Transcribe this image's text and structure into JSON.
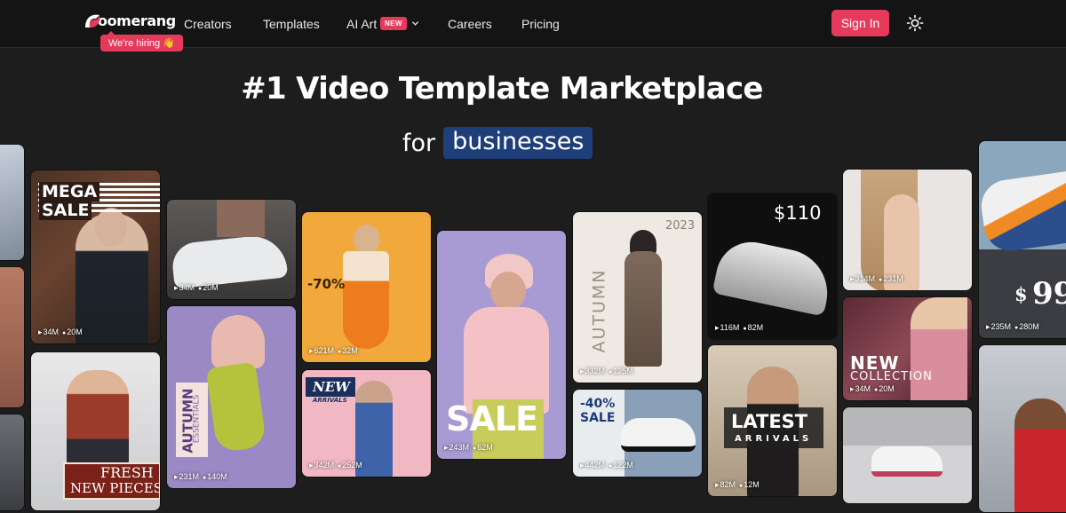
{
  "nav": {
    "logo_text": "oomerang",
    "hiring_label": "We're hiring 👋",
    "items": [
      {
        "label": "Creators"
      },
      {
        "label": "Templates"
      },
      {
        "label": "AI Art",
        "badge": "NEW"
      },
      {
        "label": "Careers"
      },
      {
        "label": "Pricing"
      }
    ],
    "signin_label": "Sign In",
    "theme_icon": "sun-icon"
  },
  "hero": {
    "title": "#1 Video Template Marketplace",
    "sub_prefix": "for",
    "sub_highlight": "businesses"
  },
  "colors": {
    "accent": "#e63a5c",
    "highlight": "#1f3f7a",
    "background": "#1d1d1d"
  },
  "templates": [
    {
      "id": "left-edge-top",
      "views": "",
      "likes": ""
    },
    {
      "id": "mega-sale",
      "overlay": [
        "MEGA",
        "SALE"
      ],
      "views": "34M",
      "likes": "20M"
    },
    {
      "id": "fresh-new-pieces",
      "overlay": [
        "FRESH",
        "NEW PIECES"
      ],
      "views": "",
      "likes": ""
    },
    {
      "id": "sneaker-closeup",
      "views": "34M",
      "likes": "20M"
    },
    {
      "id": "autumn-essentials",
      "overlay": [
        "AUTUMN",
        "ESSENTIALS"
      ],
      "views": "231M",
      "likes": "140M"
    },
    {
      "id": "seventy-off",
      "overlay": [
        "-70%"
      ],
      "views": "621M",
      "likes": "32M"
    },
    {
      "id": "new-arrivals",
      "overlay": [
        "NEW",
        "ARRIVALS"
      ],
      "views": "342M",
      "likes": "252M"
    },
    {
      "id": "sale-purple",
      "overlay": [
        "SALE"
      ],
      "views": "243M",
      "likes": "62M"
    },
    {
      "id": "autumn-2023",
      "overlay": [
        "2023",
        "AUTUMN"
      ],
      "views": "332M",
      "likes": "125M"
    },
    {
      "id": "forty-off-sale",
      "overlay": [
        "-40%",
        "SALE"
      ],
      "views": "442M",
      "likes": "122M"
    },
    {
      "id": "shoe-110",
      "overlay": [
        "$110"
      ],
      "views": "116M",
      "likes": "82M"
    },
    {
      "id": "latest-arrivals",
      "overlay": [
        "LATEST",
        "ARRIVALS"
      ],
      "views": "82M",
      "likes": "12M"
    },
    {
      "id": "beauty-portrait",
      "views": "314M",
      "likes": "231M"
    },
    {
      "id": "new-collection",
      "overlay": [
        "NEW",
        "COLLECTION"
      ],
      "views": "34M",
      "likes": "20M"
    },
    {
      "id": "pink-sneakers",
      "views": "",
      "likes": ""
    },
    {
      "id": "shoe-99",
      "overlay": [
        "$",
        "99"
      ],
      "views": "235M",
      "likes": "280M"
    },
    {
      "id": "red-jacket",
      "views": "",
      "likes": ""
    }
  ]
}
